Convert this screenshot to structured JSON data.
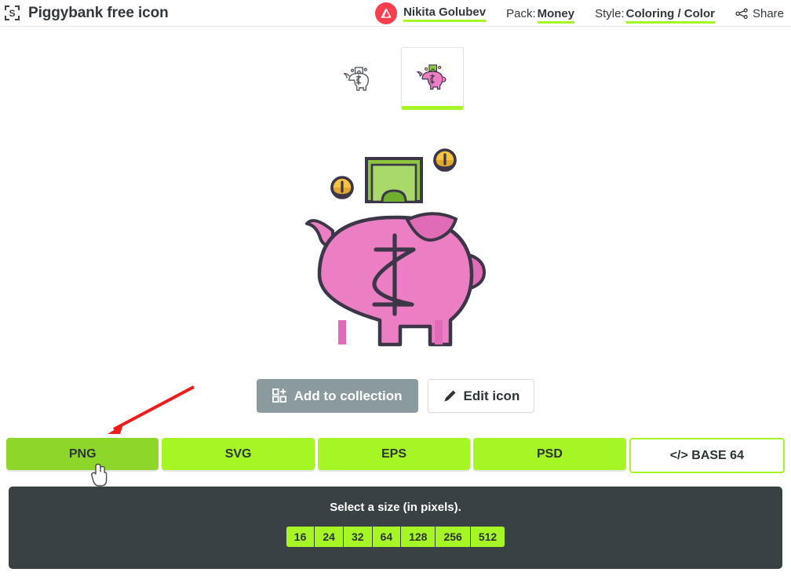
{
  "header": {
    "logo_letter": "S",
    "title": "Piggybank free icon",
    "author_name": "Nikita Golubev",
    "author_avatar_icon": "triangle-logo-icon",
    "pack_label": "Pack:",
    "pack_value": "Money",
    "style_label": "Style:",
    "style_value": "Coloring / Color",
    "share_label": "Share",
    "share_icon": "share-nodes-icon",
    "accent_green": "#a6f524",
    "avatar_color": "#fa3e4e"
  },
  "thumbnails": [
    {
      "name": "piggybank-outline-thumb",
      "selected": false
    },
    {
      "name": "piggybank-color-thumb",
      "selected": true
    }
  ],
  "preview": {
    "alt": "Piggybank color icon",
    "colors": {
      "body": "#ec7fc4",
      "body_shadow": "#e06bb6",
      "outline": "#3d3648",
      "bill": "#8cc63f",
      "bill_light": "#a9d96a",
      "coin": "#f5c242",
      "coin_dark": "#e0a92c"
    }
  },
  "actions": {
    "add_to_collection_label": "Add to collection",
    "add_to_collection_icon": "grid-plus-icon",
    "edit_icon_label": "Edit icon",
    "edit_icon_icon": "pencil-icon",
    "collection_bg": "#8b9a9c"
  },
  "formats": [
    {
      "label": "PNG",
      "style": "filled",
      "state": "hover"
    },
    {
      "label": "SVG",
      "style": "filled",
      "state": "normal"
    },
    {
      "label": "EPS",
      "style": "filled",
      "state": "normal"
    },
    {
      "label": "PSD",
      "style": "filled",
      "state": "normal"
    },
    {
      "label": "</> BASE 64",
      "style": "outline",
      "state": "normal"
    }
  ],
  "size_panel": {
    "title": "Select a size (in pixels).",
    "sizes": [
      "16",
      "24",
      "32",
      "64",
      "128",
      "256",
      "512"
    ],
    "background": "#3a4145"
  },
  "annotations": {
    "arrow_color": "#ee1c1c",
    "cursor": "pointer-hand-cursor"
  }
}
